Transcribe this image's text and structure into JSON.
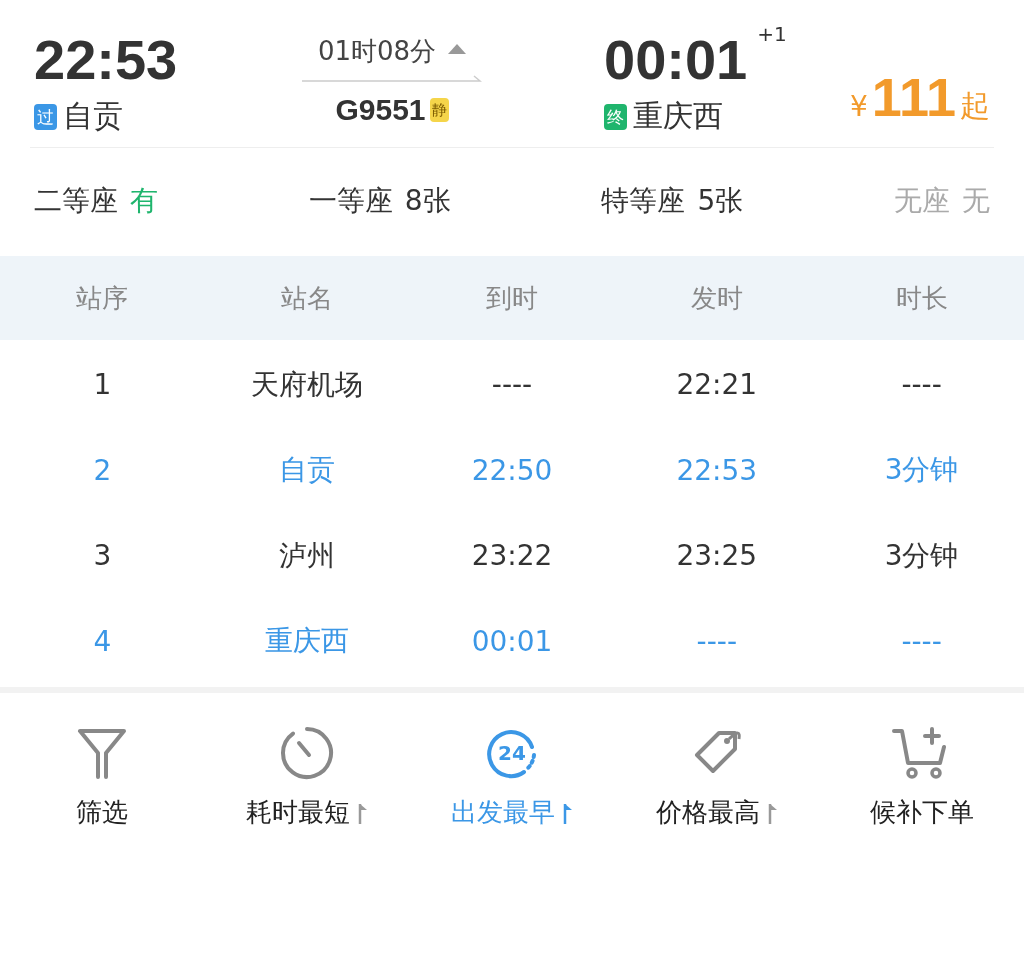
{
  "train": {
    "depart_time": "22:53",
    "depart_station": "自贡",
    "depart_tag": "过",
    "duration": "01时08分",
    "number": "G9551",
    "number_tag": "静",
    "arrive_time": "00:01",
    "arrive_day_offset": "+1",
    "arrive_station": "重庆西",
    "arrive_tag": "终",
    "price_symbol": "¥",
    "price": "111",
    "price_suffix": "起"
  },
  "seats": [
    {
      "name": "二等座",
      "count": "有",
      "kind": "plenty"
    },
    {
      "name": "一等座",
      "count": "8张",
      "kind": "some"
    },
    {
      "name": "特等座",
      "count": "5张",
      "kind": "some"
    },
    {
      "name": "无座",
      "count": "无",
      "kind": "none"
    }
  ],
  "stops_table": {
    "columns": [
      "站序",
      "站名",
      "到时",
      "发时",
      "时长"
    ],
    "rows": [
      {
        "cells": [
          "1",
          "天府机场",
          "----",
          "22:21",
          "----"
        ],
        "highlighted": false
      },
      {
        "cells": [
          "2",
          "自贡",
          "22:50",
          "22:53",
          "3分钟"
        ],
        "highlighted": true
      },
      {
        "cells": [
          "3",
          "泸州",
          "23:22",
          "23:25",
          "3分钟"
        ],
        "highlighted": false
      },
      {
        "cells": [
          "4",
          "重庆西",
          "00:01",
          "----",
          "----"
        ],
        "highlighted": true
      }
    ]
  },
  "bottom_bar": [
    {
      "label": "筛选",
      "kind": "filter",
      "sortable": false,
      "selected": false
    },
    {
      "label": "耗时最短",
      "kind": "timer",
      "sortable": true,
      "selected": false
    },
    {
      "label": "出发最早",
      "kind": "clock24",
      "icon_text": "24",
      "sortable": true,
      "selected": true
    },
    {
      "label": "价格最高",
      "kind": "tag",
      "sortable": true,
      "selected": false
    },
    {
      "label": "候补下单",
      "kind": "cart",
      "sortable": false,
      "selected": false
    }
  ]
}
